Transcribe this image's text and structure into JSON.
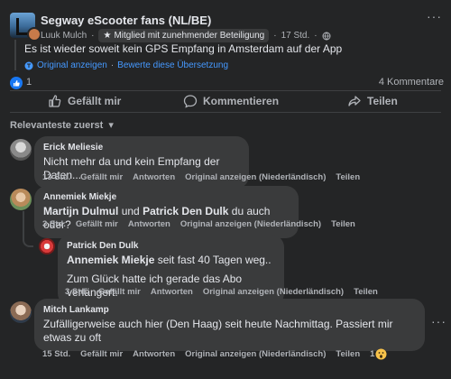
{
  "post": {
    "group_name": "Segway eScooter fans (NL/BE)",
    "author": "Luuk Mulch",
    "badge": "Mitglied mit zunehmender Beteiligung",
    "time": "17 Std.",
    "text": "Es ist wieder soweit kein GPS Empfang in Amsterdam auf der App",
    "show_original": "Original anzeigen",
    "rate_translation": "Bewerte diese Übersetzung",
    "like_count": "1",
    "comments_count": "4 Kommentare",
    "actions": {
      "like": "Gefällt mir",
      "comment": "Kommentieren",
      "share": "Teilen"
    }
  },
  "comments_section": {
    "sort_label": "Relevanteste zuerst",
    "comments": [
      {
        "name": "Erick Meliesie",
        "text": "Nicht mehr da und kein Empfang der Daten...",
        "time": "13 Std.",
        "like": "Gefällt mir",
        "reply": "Antworten",
        "original": "Original anzeigen (Niederländisch)",
        "share": "Teilen"
      },
      {
        "name": "Annemiek Miekje",
        "mention1": "Martijn Dulmul",
        "conj": "und",
        "mention2": "Patrick Den Dulk",
        "text_rest": "du auch oder?",
        "time": "3 Std.",
        "like": "Gefällt mir",
        "reply": "Antworten",
        "original": "Original anzeigen (Niederländisch)",
        "share": "Teilen"
      },
      {
        "name": "Patrick Den Dulk",
        "mention": "Annemiek Miekje",
        "text_rest": "seit fast 40 Tagen weg..",
        "text_line2": "Zum Glück hatte ich gerade das Abo verlängert.",
        "time": "3 Std.",
        "like": "Gefällt mir",
        "reply": "Antworten",
        "original": "Original anzeigen (Niederländisch)",
        "share": "Teilen"
      },
      {
        "name": "Mitch Lankamp",
        "text": "Zufälligerweise auch hier (Den Haag) seit heute Nachmittag. Passiert mir etwas zu oft",
        "time": "15 Std.",
        "like": "Gefällt mir",
        "reply": "Antworten",
        "original": "Original anzeigen (Niederländisch)",
        "share": "Teilen",
        "reaction_count": "1"
      }
    ]
  },
  "colors": {
    "background": "#242526",
    "bubble": "#3a3b3c",
    "link": "#4599ff",
    "like_blue": "#1877f2"
  }
}
